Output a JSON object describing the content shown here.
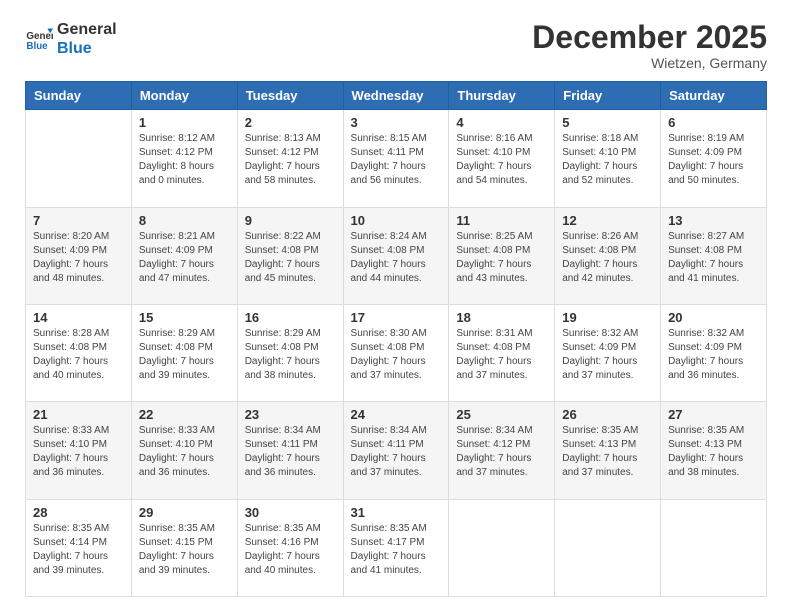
{
  "logo": {
    "line1": "General",
    "line2": "Blue"
  },
  "header": {
    "title": "December 2025",
    "location": "Wietzen, Germany"
  },
  "weekdays": [
    "Sunday",
    "Monday",
    "Tuesday",
    "Wednesday",
    "Thursday",
    "Friday",
    "Saturday"
  ],
  "weeks": [
    [
      {
        "day": "",
        "sunrise": "",
        "sunset": "",
        "daylight": ""
      },
      {
        "day": "1",
        "sunrise": "Sunrise: 8:12 AM",
        "sunset": "Sunset: 4:12 PM",
        "daylight": "Daylight: 8 hours and 0 minutes."
      },
      {
        "day": "2",
        "sunrise": "Sunrise: 8:13 AM",
        "sunset": "Sunset: 4:12 PM",
        "daylight": "Daylight: 7 hours and 58 minutes."
      },
      {
        "day": "3",
        "sunrise": "Sunrise: 8:15 AM",
        "sunset": "Sunset: 4:11 PM",
        "daylight": "Daylight: 7 hours and 56 minutes."
      },
      {
        "day": "4",
        "sunrise": "Sunrise: 8:16 AM",
        "sunset": "Sunset: 4:10 PM",
        "daylight": "Daylight: 7 hours and 54 minutes."
      },
      {
        "day": "5",
        "sunrise": "Sunrise: 8:18 AM",
        "sunset": "Sunset: 4:10 PM",
        "daylight": "Daylight: 7 hours and 52 minutes."
      },
      {
        "day": "6",
        "sunrise": "Sunrise: 8:19 AM",
        "sunset": "Sunset: 4:09 PM",
        "daylight": "Daylight: 7 hours and 50 minutes."
      }
    ],
    [
      {
        "day": "7",
        "sunrise": "Sunrise: 8:20 AM",
        "sunset": "Sunset: 4:09 PM",
        "daylight": "Daylight: 7 hours and 48 minutes."
      },
      {
        "day": "8",
        "sunrise": "Sunrise: 8:21 AM",
        "sunset": "Sunset: 4:09 PM",
        "daylight": "Daylight: 7 hours and 47 minutes."
      },
      {
        "day": "9",
        "sunrise": "Sunrise: 8:22 AM",
        "sunset": "Sunset: 4:08 PM",
        "daylight": "Daylight: 7 hours and 45 minutes."
      },
      {
        "day": "10",
        "sunrise": "Sunrise: 8:24 AM",
        "sunset": "Sunset: 4:08 PM",
        "daylight": "Daylight: 7 hours and 44 minutes."
      },
      {
        "day": "11",
        "sunrise": "Sunrise: 8:25 AM",
        "sunset": "Sunset: 4:08 PM",
        "daylight": "Daylight: 7 hours and 43 minutes."
      },
      {
        "day": "12",
        "sunrise": "Sunrise: 8:26 AM",
        "sunset": "Sunset: 4:08 PM",
        "daylight": "Daylight: 7 hours and 42 minutes."
      },
      {
        "day": "13",
        "sunrise": "Sunrise: 8:27 AM",
        "sunset": "Sunset: 4:08 PM",
        "daylight": "Daylight: 7 hours and 41 minutes."
      }
    ],
    [
      {
        "day": "14",
        "sunrise": "Sunrise: 8:28 AM",
        "sunset": "Sunset: 4:08 PM",
        "daylight": "Daylight: 7 hours and 40 minutes."
      },
      {
        "day": "15",
        "sunrise": "Sunrise: 8:29 AM",
        "sunset": "Sunset: 4:08 PM",
        "daylight": "Daylight: 7 hours and 39 minutes."
      },
      {
        "day": "16",
        "sunrise": "Sunrise: 8:29 AM",
        "sunset": "Sunset: 4:08 PM",
        "daylight": "Daylight: 7 hours and 38 minutes."
      },
      {
        "day": "17",
        "sunrise": "Sunrise: 8:30 AM",
        "sunset": "Sunset: 4:08 PM",
        "daylight": "Daylight: 7 hours and 37 minutes."
      },
      {
        "day": "18",
        "sunrise": "Sunrise: 8:31 AM",
        "sunset": "Sunset: 4:08 PM",
        "daylight": "Daylight: 7 hours and 37 minutes."
      },
      {
        "day": "19",
        "sunrise": "Sunrise: 8:32 AM",
        "sunset": "Sunset: 4:09 PM",
        "daylight": "Daylight: 7 hours and 37 minutes."
      },
      {
        "day": "20",
        "sunrise": "Sunrise: 8:32 AM",
        "sunset": "Sunset: 4:09 PM",
        "daylight": "Daylight: 7 hours and 36 minutes."
      }
    ],
    [
      {
        "day": "21",
        "sunrise": "Sunrise: 8:33 AM",
        "sunset": "Sunset: 4:10 PM",
        "daylight": "Daylight: 7 hours and 36 minutes."
      },
      {
        "day": "22",
        "sunrise": "Sunrise: 8:33 AM",
        "sunset": "Sunset: 4:10 PM",
        "daylight": "Daylight: 7 hours and 36 minutes."
      },
      {
        "day": "23",
        "sunrise": "Sunrise: 8:34 AM",
        "sunset": "Sunset: 4:11 PM",
        "daylight": "Daylight: 7 hours and 36 minutes."
      },
      {
        "day": "24",
        "sunrise": "Sunrise: 8:34 AM",
        "sunset": "Sunset: 4:11 PM",
        "daylight": "Daylight: 7 hours and 37 minutes."
      },
      {
        "day": "25",
        "sunrise": "Sunrise: 8:34 AM",
        "sunset": "Sunset: 4:12 PM",
        "daylight": "Daylight: 7 hours and 37 minutes."
      },
      {
        "day": "26",
        "sunrise": "Sunrise: 8:35 AM",
        "sunset": "Sunset: 4:13 PM",
        "daylight": "Daylight: 7 hours and 37 minutes."
      },
      {
        "day": "27",
        "sunrise": "Sunrise: 8:35 AM",
        "sunset": "Sunset: 4:13 PM",
        "daylight": "Daylight: 7 hours and 38 minutes."
      }
    ],
    [
      {
        "day": "28",
        "sunrise": "Sunrise: 8:35 AM",
        "sunset": "Sunset: 4:14 PM",
        "daylight": "Daylight: 7 hours and 39 minutes."
      },
      {
        "day": "29",
        "sunrise": "Sunrise: 8:35 AM",
        "sunset": "Sunset: 4:15 PM",
        "daylight": "Daylight: 7 hours and 39 minutes."
      },
      {
        "day": "30",
        "sunrise": "Sunrise: 8:35 AM",
        "sunset": "Sunset: 4:16 PM",
        "daylight": "Daylight: 7 hours and 40 minutes."
      },
      {
        "day": "31",
        "sunrise": "Sunrise: 8:35 AM",
        "sunset": "Sunset: 4:17 PM",
        "daylight": "Daylight: 7 hours and 41 minutes."
      },
      {
        "day": "",
        "sunrise": "",
        "sunset": "",
        "daylight": ""
      },
      {
        "day": "",
        "sunrise": "",
        "sunset": "",
        "daylight": ""
      },
      {
        "day": "",
        "sunrise": "",
        "sunset": "",
        "daylight": ""
      }
    ]
  ]
}
